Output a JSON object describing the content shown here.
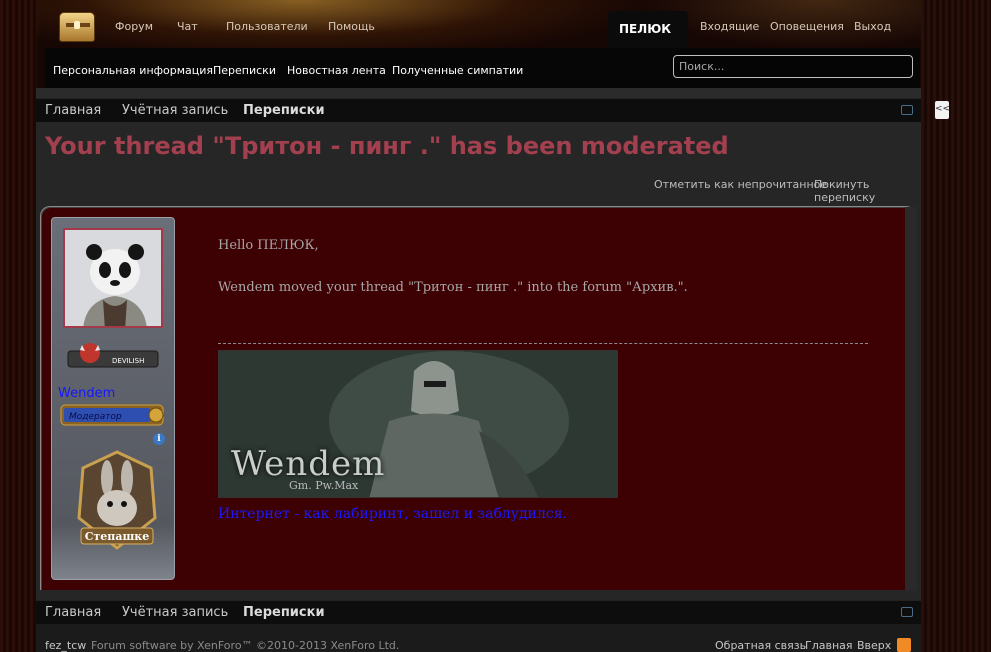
{
  "topnav": {
    "tabs": [
      "Форум",
      "Чат",
      "Пользователи",
      "Помощь"
    ],
    "user_tab": "ПЕЛЮК",
    "right_links": [
      "Входящие",
      "Оповещения",
      "Выход"
    ]
  },
  "subnav": {
    "links": [
      "Персональная информация",
      "Переписки",
      "Новостная лента",
      "Полученные симпатии"
    ],
    "search_placeholder": "Поиск..."
  },
  "breadcrumbs": {
    "items": [
      "Главная",
      "Учётная запись",
      "Переписки"
    ]
  },
  "page": {
    "title": "Your thread \"Тритон - пинг .\" has been moderated",
    "actions": [
      "Отметить как непрочитанное",
      "Покинуть переписку"
    ]
  },
  "message": {
    "author": "Wendem",
    "rank_label": "DEVILISH",
    "mod_label": "Модератор",
    "award_label": "Степашке",
    "greeting": "Hello ПЕЛЮК,",
    "body": "Wendem moved your thread \"Тритон - пинг .\" into the forum \"Архив.\".",
    "signature_banner_name": "Wendem",
    "signature_banner_sub": "Gm. Pw.Max",
    "signature_text": "Интернет - как лабиринт, зашел и заблудился."
  },
  "footer": {
    "style": "fez_tcw",
    "copyright": "Forum software by XenForo™ ©2010-2013 XenForo Ltd.",
    "links": [
      "Обратная связь",
      "Главная",
      "Вверх"
    ]
  },
  "colors": {
    "title": "#a3404f",
    "message_bg": "#3d0003",
    "username": "#1616ff",
    "signature": "#1a1aff"
  }
}
